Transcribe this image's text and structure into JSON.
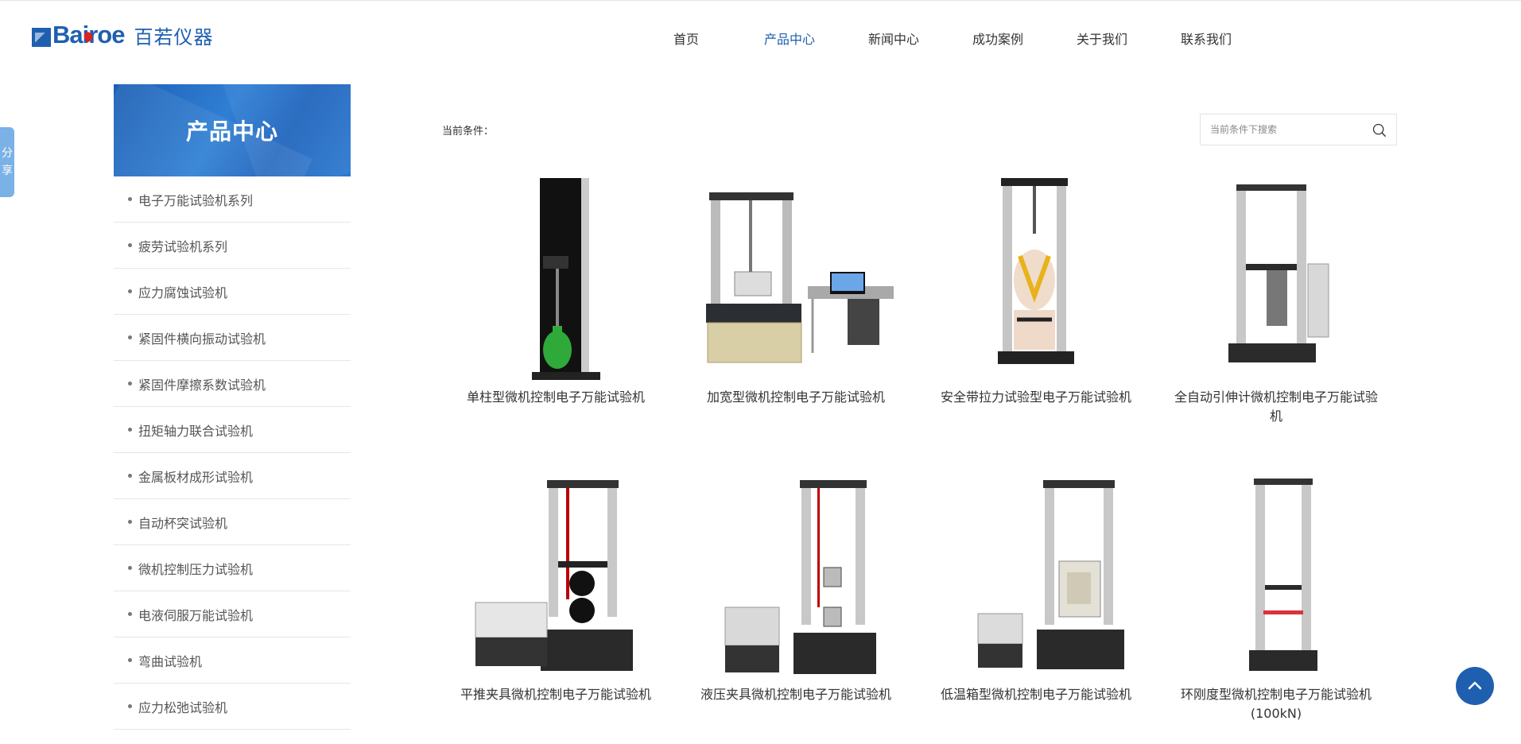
{
  "header": {
    "logo_en": "Bairoe",
    "logo_cn": "百若仪器",
    "nav": [
      "首页",
      "产品中心",
      "新闻中心",
      "成功案例",
      "关于我们",
      "联系我们"
    ],
    "active_nav": "产品中心"
  },
  "share": {
    "label_1": "分",
    "label_2": "享"
  },
  "sidebar": {
    "title": "产品中心",
    "items": [
      "电子万能试验机系列",
      "疲劳试验机系列",
      "应力腐蚀试验机",
      "紧固件横向振动试验机",
      "紧固件摩擦系数试验机",
      "扭矩轴力联合试验机",
      "金属板材成形试验机",
      "自动杯突试验机",
      "微机控制压力试验机",
      "电液伺服万能试验机",
      "弯曲试验机",
      "应力松弛试验机"
    ]
  },
  "main": {
    "condition_label": "当前条件：",
    "search_placeholder": "当前条件下搜索",
    "products": [
      "单柱型微机控制电子万能试验机",
      "加宽型微机控制电子万能试验机",
      "安全带拉力试验型电子万能试验机",
      "全自动引伸计微机控制电子万能试验机",
      "平推夹具微机控制电子万能试验机",
      "液压夹具微机控制电子万能试验机",
      "低温箱型微机控制电子万能试验机",
      "环刚度型微机控制电子万能试验机(100kN)"
    ]
  },
  "icons": {
    "search": "search-icon",
    "back_to_top": "chevron-up-icon"
  },
  "colors": {
    "brand": "#1f5fb0",
    "share_tab": "#7ab1e6"
  }
}
